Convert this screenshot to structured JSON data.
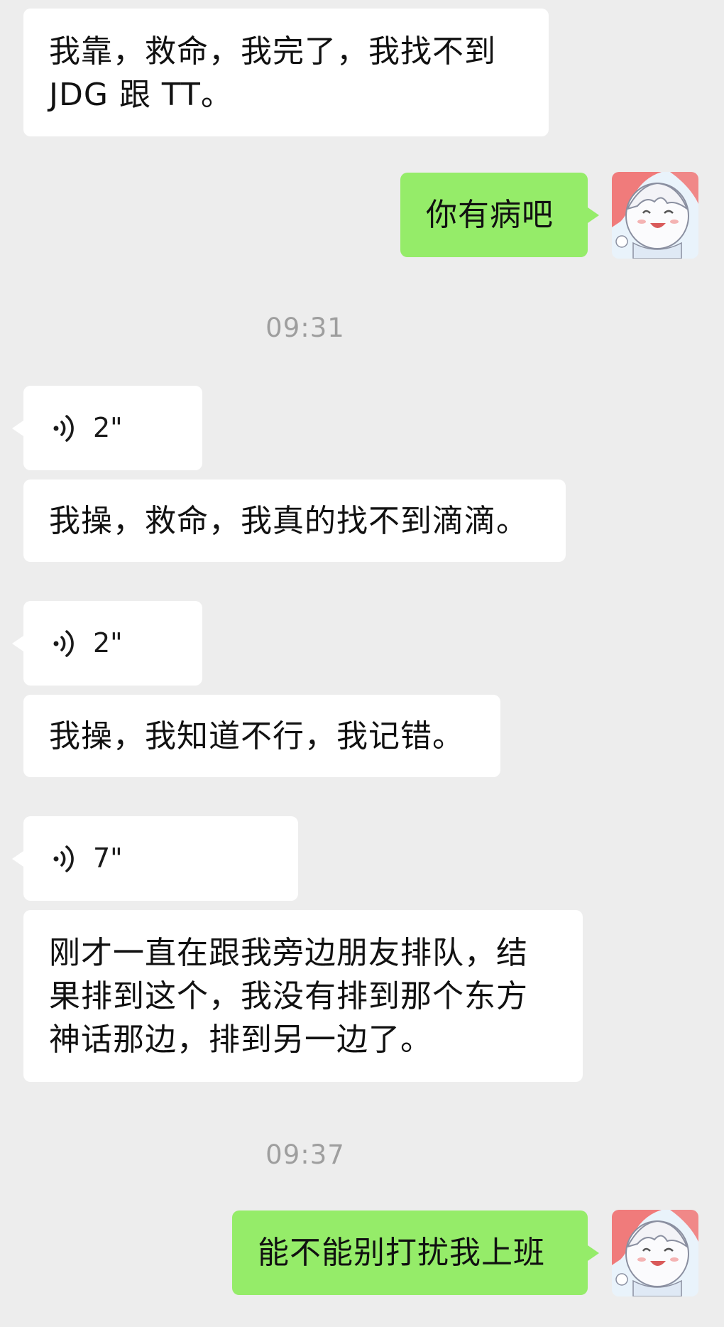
{
  "messages": [
    {
      "kind": "text",
      "text": "我靠，救命，我完了，我找不到 JDG 跟 TT。"
    },
    {
      "kind": "text",
      "text": "你有病吧"
    },
    {
      "kind": "voice",
      "duration": "2\""
    },
    {
      "kind": "text",
      "text": "我操，救命，我真的找不到滴滴。"
    },
    {
      "kind": "voice",
      "duration": "2\""
    },
    {
      "kind": "text",
      "text": "我操，我知道不行，我记错。"
    },
    {
      "kind": "voice",
      "duration": "7\""
    },
    {
      "kind": "text",
      "text": "刚才一直在跟我旁边朋友排队，结果排到这个，我没有排到那个东方神话那边，排到另一边了。"
    },
    {
      "kind": "text",
      "text": "能不能别打扰我上班"
    }
  ],
  "timestamps": [
    "09:31",
    "09:37"
  ],
  "icons": {
    "voice": "voice-wave-icon",
    "avatar": "anime-girl-avatar"
  },
  "colors": {
    "background": "#ededed",
    "incoming_bubble": "#ffffff",
    "outgoing_bubble": "#95ec69",
    "timestamp": "#9e9e9e"
  }
}
